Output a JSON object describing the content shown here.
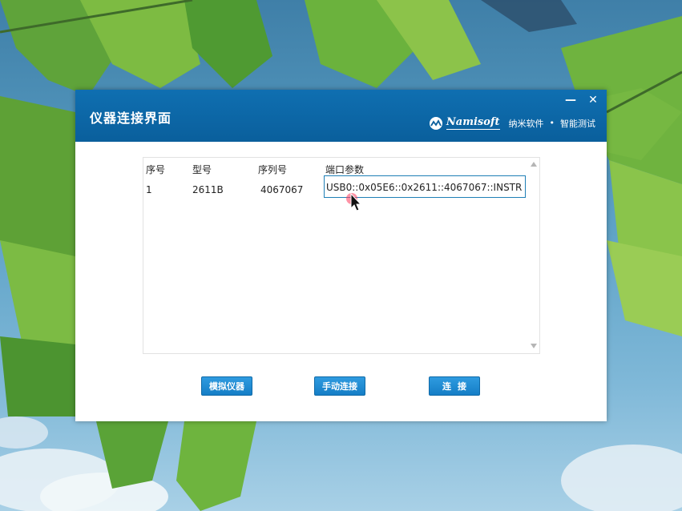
{
  "window": {
    "title": "仪器连接界面",
    "minimize_label": "—",
    "close_label": "✕"
  },
  "brand": {
    "name": "Namisoft",
    "cn_left": "纳米软件",
    "separator": "•",
    "cn_right": "智能测试"
  },
  "table": {
    "headers": [
      "序号",
      "型号",
      "序列号",
      "端口参数"
    ],
    "rows": [
      [
        "1",
        "2611B",
        "4067067",
        "USB0::0x05E6::0x2611::4067067::INSTR"
      ]
    ]
  },
  "buttons": {
    "simulate": "模拟仪器",
    "manual_connect": "手动连接",
    "connect": "连接"
  },
  "colors": {
    "titlebar": "#0a5f9c",
    "button": "#1a86cf",
    "selection_border": "#1f7fb6"
  }
}
